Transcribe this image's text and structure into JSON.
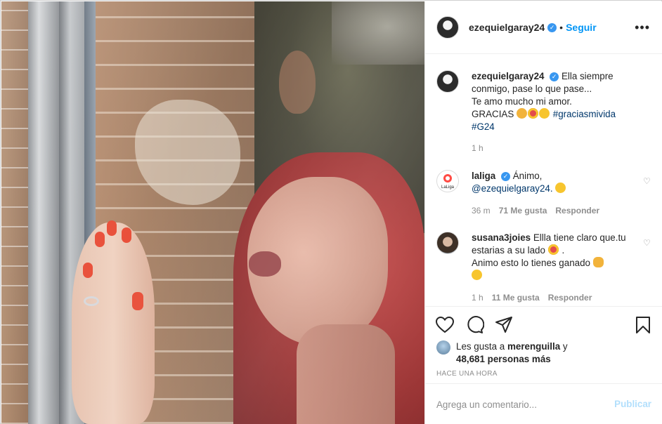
{
  "post": {
    "author": "ezequielgaray24",
    "follow_label": "Seguir",
    "separator": "•",
    "more_label": "•••"
  },
  "caption": {
    "username": "ezequielgaray24",
    "line1": "Ella siempre conmigo, pase lo que pase...",
    "line2": "Te amo mucho mi amor.",
    "line3": "GRACIAS",
    "hashtag1": "#graciasmivida",
    "hashtag2": "#G24",
    "time": "1 h"
  },
  "comments": [
    {
      "username": "laliga",
      "text": "Ánimo,",
      "mention": "@ezequielgaray24.",
      "time": "36 m",
      "likes": "71 Me gusta",
      "reply": "Responder",
      "avatar_text": "LaLiga"
    },
    {
      "username": "susana3joies",
      "text": "Ellla tiene claro que.tu estarias a su lado",
      "text2": ".",
      "text3": "Animo esto lo tienes ganado",
      "time": "1 h",
      "likes": "11 Me gusta",
      "reply": "Responder"
    }
  ],
  "likes": {
    "prefix": "Les gusta a",
    "user": "merenguilla",
    "suffix": "y",
    "count": "48,681 personas más"
  },
  "timestamp": "HACE UNA HORA",
  "comment_box": {
    "placeholder": "Agrega un comentario...",
    "publish_label": "Publicar"
  },
  "icons": [
    "verified-icon",
    "more-icon",
    "heart-icon",
    "comment-icon",
    "share-icon",
    "bookmark-icon"
  ],
  "colors": {
    "link_blue": "#0095f6",
    "hashtag": "#00376b",
    "muted": "#8e8e8e",
    "publish_disabled": "#b2dffc",
    "verified": "#3897f0"
  }
}
